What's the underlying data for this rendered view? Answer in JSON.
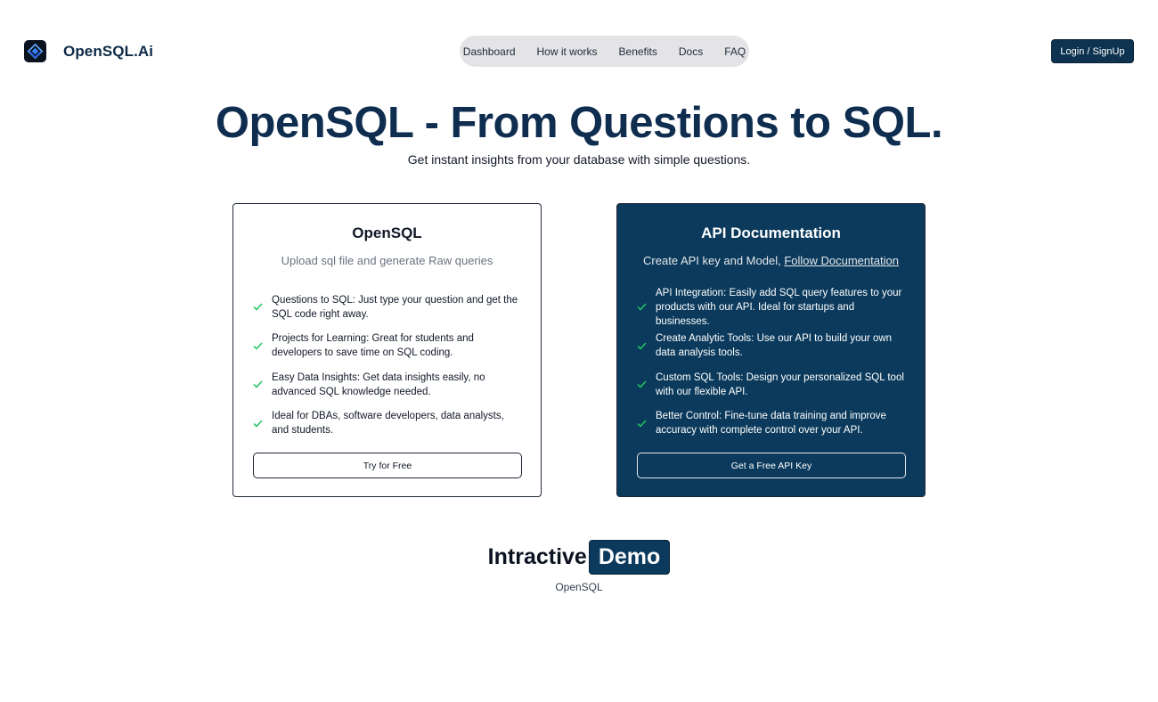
{
  "brand": {
    "name": "OpenSQL.Ai",
    "logo_icon": "diamond-logo-icon"
  },
  "nav": {
    "items": [
      {
        "label": "Dashboard"
      },
      {
        "label": "How it works"
      },
      {
        "label": "Benefits"
      },
      {
        "label": "Docs"
      },
      {
        "label": "FAQ"
      }
    ]
  },
  "header": {
    "login_label": "Login / SignUp"
  },
  "hero": {
    "title": "OpenSQL - From Questions to SQL.",
    "subtitle": "Get instant insights from your database with simple questions."
  },
  "cards": {
    "opensql": {
      "title": "OpenSQL",
      "description": "Upload sql file and generate Raw queries",
      "features": [
        "Questions to SQL: Just type your question and get the SQL code right away.",
        "Projects for Learning: Great for students and developers to save time on SQL coding.",
        "Easy Data Insights: Get data insights easily, no advanced SQL knowledge needed.",
        "Ideal for DBAs, software developers, data analysts, and students."
      ],
      "cta_label": "Try for Free"
    },
    "api": {
      "title": "API Documentation",
      "description_prefix": "Create API key and Model, ",
      "description_link": "Follow Documentation",
      "features": [
        "API Integration: Easily add SQL query features to your products with our API. Ideal for startups and businesses.",
        "Create Analytic Tools: Use our API to build your own data analysis tools.",
        "Custom SQL Tools: Design your personalized SQL tool with our flexible API.",
        "Better Control: Fine-tune data training and improve accuracy with complete control over your API."
      ],
      "cta_label": "Get a Free API Key"
    }
  },
  "demo": {
    "title_word": "Intractive",
    "title_badge": "Demo",
    "subtitle": "OpenSQL"
  },
  "colors": {
    "brand_dark": "#0e2d4f",
    "card_dark": "#0b3a5c",
    "check_green": "#22c55e",
    "nav_bg": "#e4e4e7"
  }
}
